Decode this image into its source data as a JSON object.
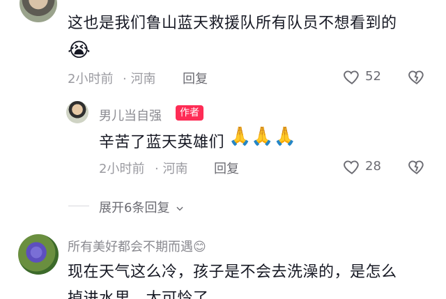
{
  "comments": [
    {
      "text": "这也是我们鲁山蓝天救援队所有队员不想看到的",
      "emoji": "😭",
      "time": "2小时前",
      "location": "· 河南",
      "reply_label": "回复",
      "likes": "52"
    }
  ],
  "reply": {
    "username": "男儿当自强",
    "badge": "作者",
    "text": "辛苦了蓝天英雄们",
    "emoji": "🙏🙏🙏",
    "time": "2小时前",
    "location": "· 河南",
    "reply_label": "回复",
    "likes": "28"
  },
  "expand": {
    "label": "展开6条回复"
  },
  "comment3": {
    "username": "所有美好都会不期而遇",
    "username_emoji": "😊",
    "line1": "现在天气这么冷，孩子是不会去洗澡的，是怎么",
    "line2": "掉进水里，太可怜了"
  },
  "colors": {
    "badge": "#fe2c55",
    "meta": "#9a9aa0",
    "text": "#161823"
  }
}
